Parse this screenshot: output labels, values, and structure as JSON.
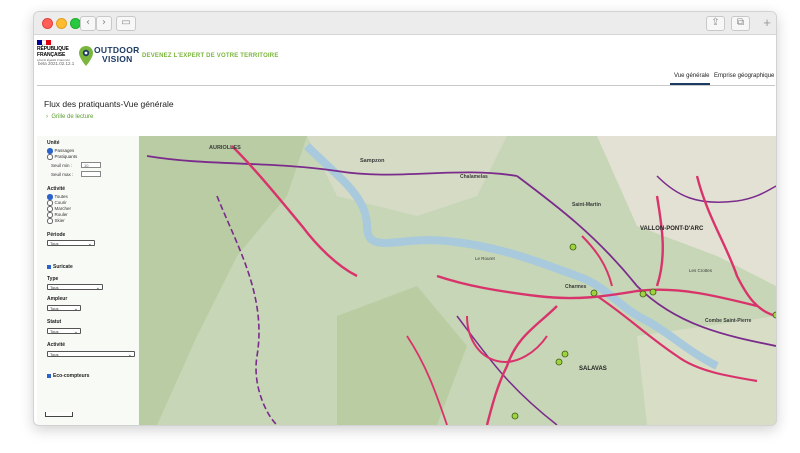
{
  "header": {
    "republique_line1": "RÉPUBLIQUE",
    "republique_line2": "FRANÇAISE",
    "motto": "Liberté Égalité Fraternité",
    "brand_line1": "OUTDOOR",
    "brand_line2": "VISION",
    "tagline": "DEVENEZ L'EXPERT DE VOTRE TERRITOIRE",
    "version": "beta 2021.02.12.1",
    "tabs": [
      {
        "label": "Vue générale",
        "active": true
      },
      {
        "label": "Emprise géographique",
        "active": false
      }
    ]
  },
  "page": {
    "title": "Flux des pratiquants-Vue générale",
    "grille": "Grille de lecture"
  },
  "filters": {
    "unite_label": "Unité",
    "unite_options": [
      "Passages",
      "Pratiquants"
    ],
    "seuil_min_label": "Seuil min :",
    "seuil_min_value": "10",
    "seuil_max_label": "Seuil max :",
    "seuil_max_value": "",
    "activite_label": "Activité",
    "activite_options": [
      "Toutes",
      "Courir",
      "Marcher",
      "Rouler",
      "Skier"
    ],
    "periode_label": "Période",
    "periode_value": "Tous",
    "suricate_label": "Suricate",
    "type_label": "Type",
    "type_value": "Tous",
    "ampleur_label": "Ampleur",
    "ampleur_value": "Tous",
    "statut_label": "Statut",
    "statut_value": "Tous",
    "activite2_label": "Activité",
    "activite2_value": "Tous",
    "eco_label": "Eco-compteurs"
  },
  "map": {
    "labels": [
      {
        "text": "AURIOLLES"
      },
      {
        "text": "Sampzon"
      },
      {
        "text": "Chalamelas"
      },
      {
        "text": "Saint-Martin"
      },
      {
        "text": "VALLON-PONT-D'ARC"
      },
      {
        "text": "Charmes"
      },
      {
        "text": "SALAVAS"
      },
      {
        "text": "Combe Saint-Pierre"
      },
      {
        "text": "Le Rouret"
      },
      {
        "text": "Les Crottes"
      }
    ],
    "colors": {
      "terrain": "#c6d6b6",
      "water": "#a9c9dc",
      "trail": "#d9336b",
      "route": "#7a2b8c",
      "counter": "#9ed23f"
    }
  }
}
